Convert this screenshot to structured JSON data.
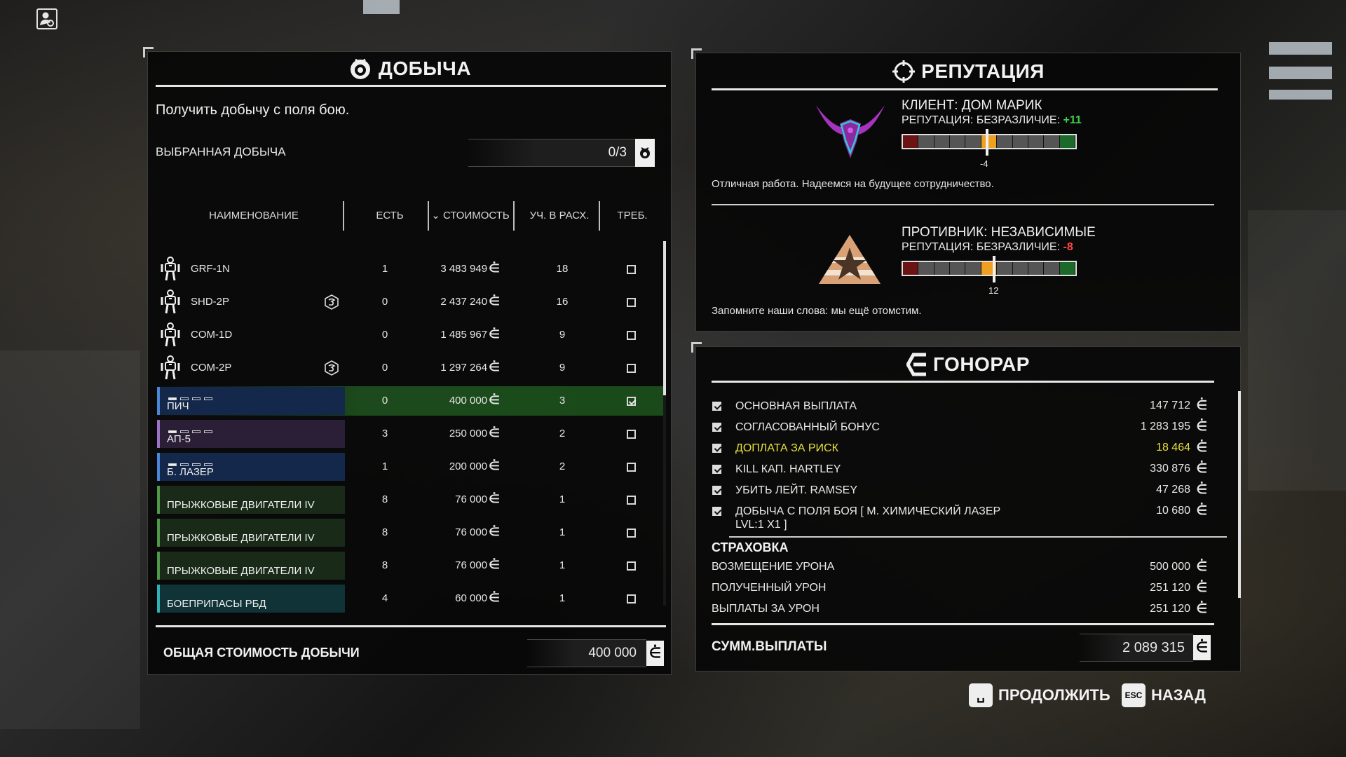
{
  "loot": {
    "title": "ДОБЫЧА",
    "description": "Получить добычу с поля бою.",
    "selected_label": "ВЫБРАННАЯ ДОБЫЧА",
    "selected_value": "0/3",
    "columns": {
      "name": "НАИМЕНОВАНИЕ",
      "have": "ЕСТЬ",
      "cost": "⌄ СТОИМОСТЬ",
      "shares": "УЧ. В РАСХ.",
      "req": "ТРЕБ."
    },
    "rows": [
      {
        "name": "GRF-1N",
        "kind": "mech",
        "have": "1",
        "cost": "3 483 949",
        "shares": "18",
        "checked": false,
        "badge": false
      },
      {
        "name": "SHD-2P",
        "kind": "mech",
        "have": "0",
        "cost": "2 437 240",
        "shares": "16",
        "checked": false,
        "badge": true
      },
      {
        "name": "COM-1D",
        "kind": "mech",
        "have": "0",
        "cost": "1 485 967",
        "shares": "9",
        "checked": false,
        "badge": false
      },
      {
        "name": "COM-2P",
        "kind": "mech",
        "have": "0",
        "cost": "1 297 264",
        "shares": "9",
        "checked": false,
        "badge": true
      },
      {
        "name": "ПИЧ",
        "kind": "weapon-blue",
        "have": "0",
        "cost": "400 000",
        "shares": "3",
        "checked": true,
        "badge": false
      },
      {
        "name": "АП-5",
        "kind": "weapon-purple",
        "have": "3",
        "cost": "250 000",
        "shares": "2",
        "checked": false,
        "badge": false
      },
      {
        "name": "Б. ЛАЗЕР",
        "kind": "weapon-blue",
        "have": "1",
        "cost": "200 000",
        "shares": "2",
        "checked": false,
        "badge": false
      },
      {
        "name": "ПРЫЖКОВЫЕ ДВИГАТЕЛИ IV",
        "kind": "equip-green",
        "have": "8",
        "cost": "76 000",
        "shares": "1",
        "checked": false,
        "badge": false
      },
      {
        "name": "ПРЫЖКОВЫЕ ДВИГАТЕЛИ IV",
        "kind": "equip-green",
        "have": "8",
        "cost": "76 000",
        "shares": "1",
        "checked": false,
        "badge": false
      },
      {
        "name": "ПРЫЖКОВЫЕ ДВИГАТЕЛИ IV",
        "kind": "equip-green",
        "have": "8",
        "cost": "76 000",
        "shares": "1",
        "checked": false,
        "badge": false
      },
      {
        "name": "БОЕПРИПАСЫ РБД",
        "kind": "ammo-teal",
        "have": "4",
        "cost": "60 000",
        "shares": "1",
        "checked": false,
        "badge": false
      }
    ],
    "total_label": "ОБЩАЯ СТОИМОСТЬ ДОБЫЧИ",
    "total_value": "400 000"
  },
  "reputation": {
    "title": "РЕПУТАЦИЯ",
    "client": {
      "name": "КЛИЕНТ: ДОМ МАРИК",
      "rep_label": "РЕПУТАЦИЯ: БЕЗРАЗЛИЧИЕ:",
      "rep_change": "+11",
      "marker_value": "-4",
      "message": "Отличная работа. Надеемся на будущее сотрудничество."
    },
    "enemy": {
      "name": "ПРОТИВНИК: НЕЗАВИСИМЫЕ",
      "rep_label": "РЕПУТАЦИЯ: БЕЗРАЗЛИЧИЕ:",
      "rep_change": "-8",
      "marker_value": "12",
      "message": "Запомните наши слова: мы ещё отомстим."
    }
  },
  "payment": {
    "title": "ГОНОРАР",
    "items": [
      {
        "label": "ОСНОВНАЯ ВЫПЛАТА",
        "value": "147 712",
        "checked": true,
        "highlight": false
      },
      {
        "label": "СОГЛАСОВАННЫЙ БОНУС",
        "value": "1 283 195",
        "checked": true,
        "highlight": false
      },
      {
        "label": "ДОПЛАТА ЗА РИСК",
        "value": "18 464",
        "checked": true,
        "highlight": true
      },
      {
        "label": "KILL КАП. HARTLEY",
        "value": "330 876",
        "checked": true,
        "highlight": false
      },
      {
        "label": "УБИТЬ  ЛЕЙТ. RAMSEY",
        "value": "47 268",
        "checked": true,
        "highlight": false
      },
      {
        "label": "ДОБЫЧА С ПОЛЯ БОЯ   [ М. ХИМИЧЕСКИЙ ЛАЗЕР LVL:1 X1 ]",
        "value": "10 680",
        "checked": true,
        "highlight": false
      }
    ],
    "insurance_title": "СТРАХОВКА",
    "insurance": [
      {
        "label": "ВОЗМЕЩЕНИЕ УРОНА",
        "value": "500 000"
      },
      {
        "label": "ПОЛУЧЕННЫЙ УРОН",
        "value": "251 120"
      },
      {
        "label": "ВЫПЛАТЫ ЗА УРОН",
        "value": "251 120"
      }
    ],
    "total_label": "СУММ.ВЫПЛАТЫ",
    "total_value": "2 089 315"
  },
  "actions": {
    "continue_key": "␣",
    "continue_label": "ПРОДОЛЖИТЬ",
    "back_key": "ESC",
    "back_label": "НАЗАД"
  },
  "colors": {
    "positive": "#3fcf4f",
    "negative": "#ff4646",
    "highlight": "#e7e13a",
    "rep_marker": "#f0a020"
  }
}
